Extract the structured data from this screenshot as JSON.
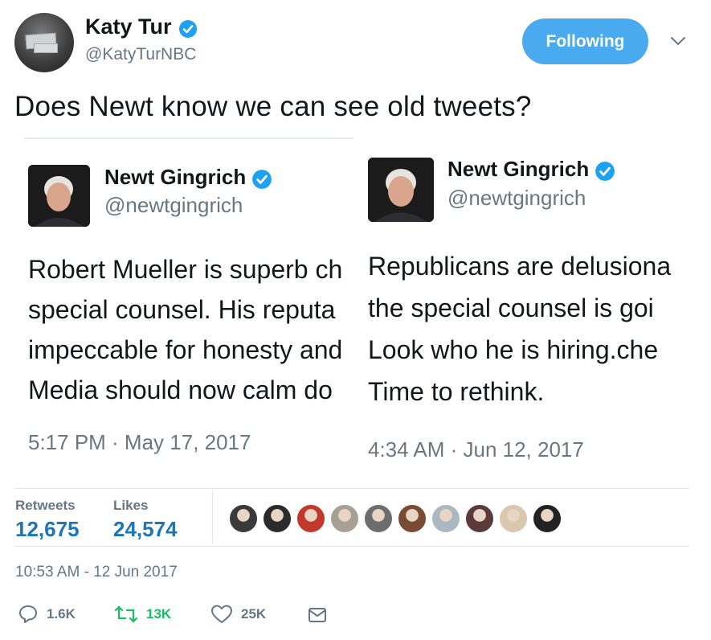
{
  "author": {
    "name": "Katy Tur",
    "handle": "@KatyTurNBC",
    "avatar_card_text": "Katy"
  },
  "follow_button": {
    "label": "Following"
  },
  "tweet_text": "Does Newt know we can see old tweets?",
  "quoted_tweets": [
    {
      "name": "Newt Gingrich",
      "handle": "@newtgingrich",
      "lines": [
        "Robert Mueller is superb ch",
        "special counsel. His reputa",
        "impeccable for honesty and",
        "Media should now calm do"
      ],
      "time": "5:17 PM · May 17, 2017"
    },
    {
      "name": "Newt Gingrich",
      "handle": "@newtgingrich",
      "lines": [
        "Republicans are delusiona",
        "the special counsel is goi",
        "Look who he is hiring.che",
        "Time to rethink."
      ],
      "time": "4:34 AM · Jun 12, 2017"
    }
  ],
  "stats": {
    "retweets_label": "Retweets",
    "retweets_value": "12,675",
    "likes_label": "Likes",
    "likes_value": "24,574"
  },
  "likers": [
    {
      "icon": "liker-avatar",
      "color": "#3a3a3a"
    },
    {
      "icon": "liker-avatar",
      "color": "#2b2b2b"
    },
    {
      "icon": "liker-avatar",
      "color": "#c0392b"
    },
    {
      "icon": "liker-avatar",
      "color": "#a89f96"
    },
    {
      "icon": "liker-avatar",
      "color": "#6d6d6d"
    },
    {
      "icon": "liker-avatar",
      "color": "#7a4b33"
    },
    {
      "icon": "liker-avatar",
      "color": "#aab8c2"
    },
    {
      "icon": "liker-avatar",
      "color": "#5a3a3a"
    },
    {
      "icon": "liker-avatar",
      "color": "#d9c7b0"
    },
    {
      "icon": "liker-avatar",
      "color": "#222222"
    }
  ],
  "timestamp": "10:53 AM - 12 Jun 2017",
  "actions": {
    "reply_count": "1.6K",
    "retweet_count": "13K",
    "like_count": "25K"
  },
  "colors": {
    "accent": "#4aaaf0",
    "retweet_green": "#17bf63",
    "verified_blue": "#1da1f2",
    "stat_blue": "#1b75bb"
  }
}
